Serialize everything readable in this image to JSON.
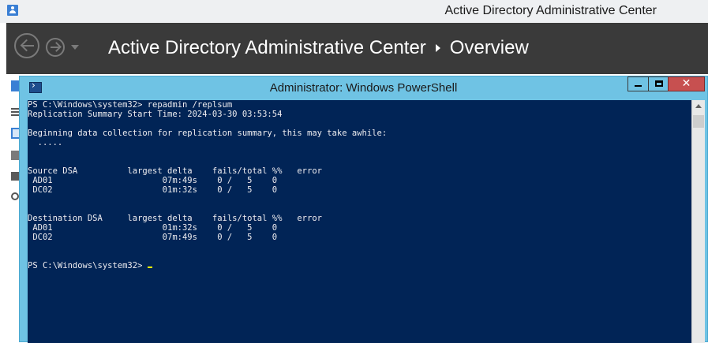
{
  "adac": {
    "window_title": "Active Directory Administrative Center",
    "breadcrumb": [
      "Active Directory Administrative Center",
      "Overview"
    ]
  },
  "powershell": {
    "window_title": "Administrator: Windows PowerShell",
    "close_glyph": "✕",
    "console_lines": [
      "PS C:\\Windows\\system32> repadmin /replsum",
      "Replication Summary Start Time: 2024-03-30 03:53:54",
      "",
      "Beginning data collection for replication summary, this may take awhile:",
      "  .....",
      "",
      "",
      "Source DSA          largest delta    fails/total %%   error",
      " AD01                      07m:49s    0 /   5    0",
      " DC02                      01m:32s    0 /   5    0",
      "",
      "",
      "Destination DSA     largest delta    fails/total %%   error",
      " AD01                      01m:32s    0 /   5    0",
      " DC02                      07m:49s    0 /   5    0",
      "",
      "",
      "PS C:\\Windows\\system32> "
    ]
  },
  "colors": {
    "console_background": "#012456",
    "console_text": "#eeedf0",
    "window_frame": "#6fc3e4",
    "adac_header": "#3a3a3a",
    "close_button": "#c75050",
    "cursor": "#ffff00"
  },
  "icons": {
    "adac_app": "adac-app-icon",
    "back": "back-arrow-icon",
    "forward": "forward-arrow-icon",
    "powershell": "powershell-icon"
  }
}
